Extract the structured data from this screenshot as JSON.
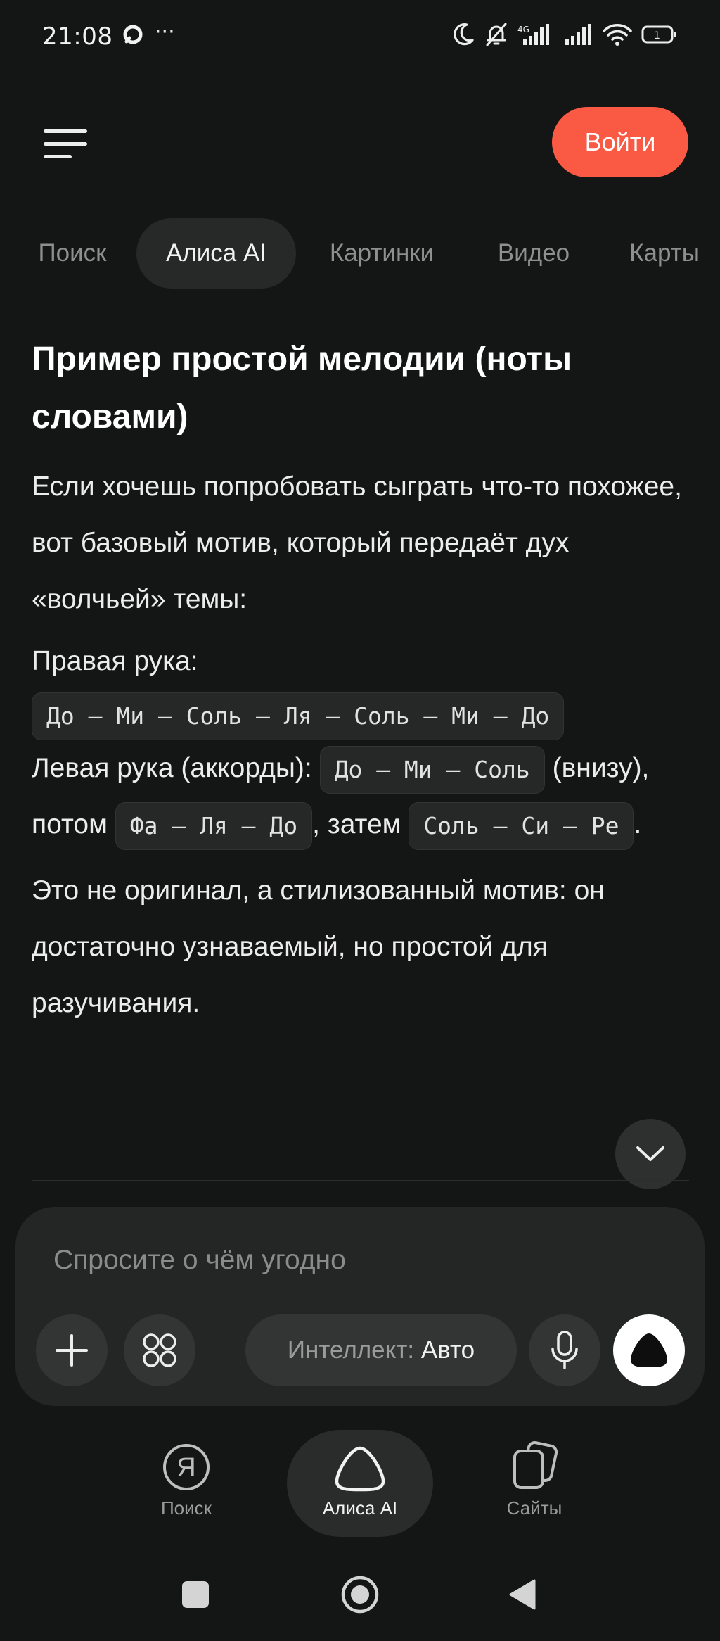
{
  "status_bar": {
    "time": "21:08",
    "dots": "···"
  },
  "header": {
    "login_label": "Войти"
  },
  "tabs": [
    {
      "label": "Поиск",
      "active": false
    },
    {
      "label": "Алиса AI",
      "active": true
    },
    {
      "label": "Картинки",
      "active": false
    },
    {
      "label": "Видео",
      "active": false
    },
    {
      "label": "Карты",
      "active": false
    }
  ],
  "content": {
    "heading": "Пример простой мелодии (ноты словами)",
    "intro": "Если хочешь попробовать сыграть что-то похожее, вот базовый мотив, который передаёт дух «волчьей» темы:",
    "right_hand_label": "Правая рука:",
    "right_hand_notes": "До – Ми – Соль – Ля – Соль – Ми – До",
    "left_hand_label": "Левая рука (аккорды):",
    "chord1": "До – Ми – Соль",
    "below_then": "(внизу), потом",
    "chord2": "Фа – Ля – До",
    "then_word": ", затем",
    "chord3": "Соль – Си – Ре",
    "period": ".",
    "outro": "Это не оригинал, а стилизованный мотив: он достаточно узнаваемый, но простой для разучивания."
  },
  "composer": {
    "placeholder": "Спросите о чём угодно",
    "mode_label": "Интеллект:",
    "mode_value": "Авто"
  },
  "bottom_nav": [
    {
      "label": "Поиск",
      "icon": "yandex-ya-icon",
      "active": false
    },
    {
      "label": "Алиса AI",
      "icon": "alice-icon",
      "active": true
    },
    {
      "label": "Сайты",
      "icon": "sites-icon",
      "active": false
    }
  ],
  "colors": {
    "background": "#141615",
    "accent": "#FA5A44",
    "chip_bg": "#262827",
    "surface": "#242625"
  }
}
